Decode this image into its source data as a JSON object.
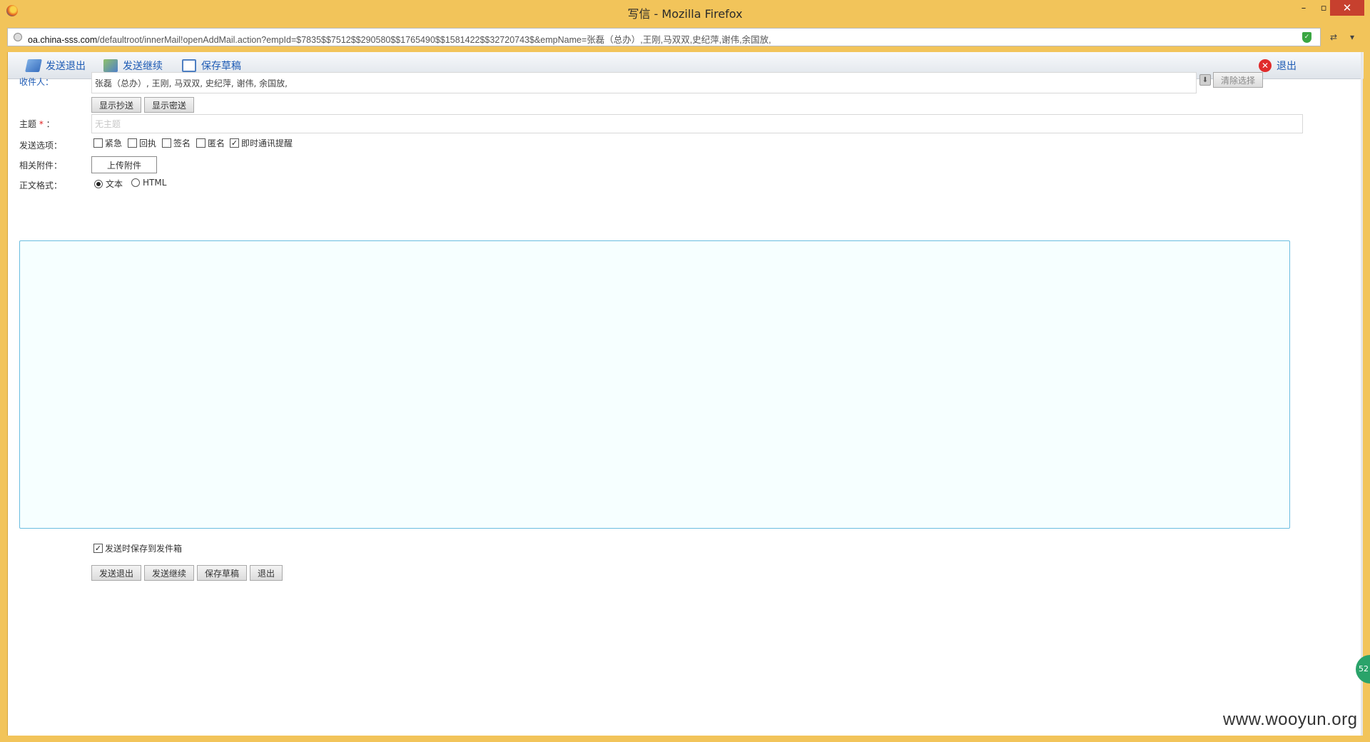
{
  "window": {
    "title": "写信 - Mozilla Firefox",
    "minimize": "–",
    "maximize": "▫",
    "close": "✕"
  },
  "urlbar": {
    "host": "oa.china-sss.com",
    "path": "/defaultroot/innerMail!openAddMail.action?empId=$7835$$7512$$290580$$1765490$$1581422$$32720743$&empName=张磊（总办）,王刚,马双双,史纪萍,谢伟,余国放,"
  },
  "toolbar": {
    "send_exit": "发送退出",
    "send_continue": "发送继续",
    "save_draft": "保存草稿",
    "exit": "退出"
  },
  "form": {
    "recipient_label": "收件人：",
    "recipients": "张磊（总办）, 王刚, 马双双, 史纪萍, 谢伟, 余国放,",
    "clear_selection": "清除选择",
    "show_cc": "显示抄送",
    "show_bcc": "显示密送",
    "subject_label": "主题",
    "subject_required": "*",
    "subject_colon": "：",
    "subject_placeholder": "无主题",
    "send_options_label": "发送选项：",
    "options": [
      {
        "label": "紧急",
        "checked": false
      },
      {
        "label": "回执",
        "checked": false
      },
      {
        "label": "签名",
        "checked": false
      },
      {
        "label": "匿名",
        "checked": false
      },
      {
        "label": "即时通讯提醒",
        "checked": true
      }
    ],
    "attachment_label": "相关附件：",
    "upload_attachment": "上传附件",
    "body_format_label": "正文格式：",
    "format_text": "文本",
    "format_html": "HTML",
    "format_selected": "文本",
    "save_to_sent": "发送时保存到发件箱",
    "save_to_sent_checked": true
  },
  "bottom_buttons": {
    "send_exit": "发送退出",
    "send_continue": "发送继续",
    "save_draft": "保存草稿",
    "exit": "退出"
  },
  "badge": "52",
  "watermark": "www.wooyun.org",
  "colors": {
    "frame": "#f2c45a",
    "link_blue": "#1e5bb5",
    "editor_border": "#6bbde0",
    "editor_bg": "#f6ffff",
    "close_red": "#c7402e"
  }
}
